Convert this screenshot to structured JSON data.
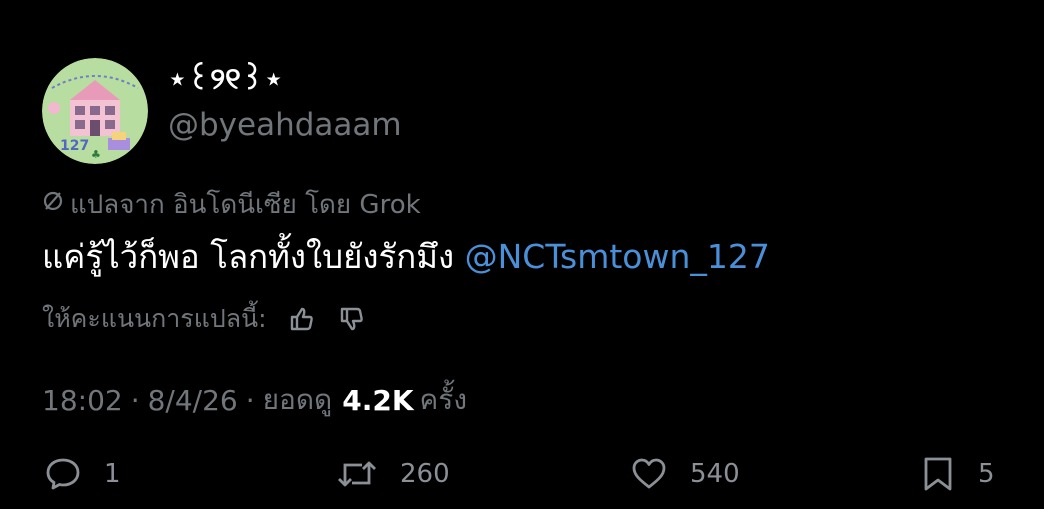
{
  "tweet": {
    "display_name": "⋆꒰୨୧꒱⋆",
    "handle": "@byeahdaaam",
    "avatar_icon": "avatar-house-illustration",
    "translation_note": "แปลจาก อินโดนีเซีย โดย Grok",
    "text_main": "แค่รู้ไว้ก็พอ โลกทั้งใบยังรักมึง ",
    "mention": "@NCTsmtown_127",
    "rate_label": "ให้คะแนนการแปลนี้:",
    "time": "18:02",
    "date": "8/4/26",
    "views_label": "ยอดดู",
    "views_count": "4.2K",
    "views_suffix": "ครั้ง",
    "separator": "·"
  },
  "actions": {
    "reply_count": "1",
    "retweet_count": "260",
    "like_count": "540",
    "bookmark_count": "5"
  },
  "colors": {
    "background": "#000000",
    "text_primary": "#ffffff",
    "text_secondary": "#71767b",
    "mention": "#4a90d9"
  }
}
